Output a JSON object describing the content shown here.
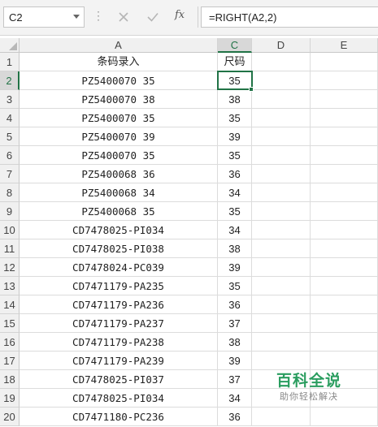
{
  "formula_bar": {
    "name_box": "C2",
    "dots": "⋮",
    "fx_label": "fx",
    "formula": "=RIGHT(A2,2)"
  },
  "columns": [
    "A",
    "C",
    "D",
    "E"
  ],
  "rows": [
    {
      "n": "1",
      "a": "条码录入",
      "c": "尺码"
    },
    {
      "n": "2",
      "a": "PZ5400070 35",
      "c": "35"
    },
    {
      "n": "3",
      "a": "PZ5400070 38",
      "c": "38"
    },
    {
      "n": "4",
      "a": "PZ5400070 35",
      "c": "35"
    },
    {
      "n": "5",
      "a": "PZ5400070 39",
      "c": "39"
    },
    {
      "n": "6",
      "a": "PZ5400070 35",
      "c": "35"
    },
    {
      "n": "7",
      "a": "PZ5400068 36",
      "c": "36"
    },
    {
      "n": "8",
      "a": "PZ5400068 34",
      "c": "34"
    },
    {
      "n": "9",
      "a": "PZ5400068 35",
      "c": "35"
    },
    {
      "n": "10",
      "a": "CD7478025-PI034",
      "c": "34"
    },
    {
      "n": "11",
      "a": "CD7478025-PI038",
      "c": "38"
    },
    {
      "n": "12",
      "a": "CD7478024-PC039",
      "c": "39"
    },
    {
      "n": "13",
      "a": "CD7471179-PA235",
      "c": "35"
    },
    {
      "n": "14",
      "a": "CD7471179-PA236",
      "c": "36"
    },
    {
      "n": "15",
      "a": "CD7471179-PA237",
      "c": "37"
    },
    {
      "n": "16",
      "a": "CD7471179-PA238",
      "c": "38"
    },
    {
      "n": "17",
      "a": "CD7471179-PA239",
      "c": "39"
    },
    {
      "n": "18",
      "a": "CD7478025-PI037",
      "c": "37"
    },
    {
      "n": "19",
      "a": "CD7478025-PI034",
      "c": "34"
    },
    {
      "n": "20",
      "a": "CD7471180-PC236",
      "c": "36"
    }
  ],
  "watermark": {
    "logo": "百科全说",
    "tagline": "助你轻松解决"
  },
  "colors": {
    "accent": "#217346",
    "watermark": "#2a9d5f"
  }
}
